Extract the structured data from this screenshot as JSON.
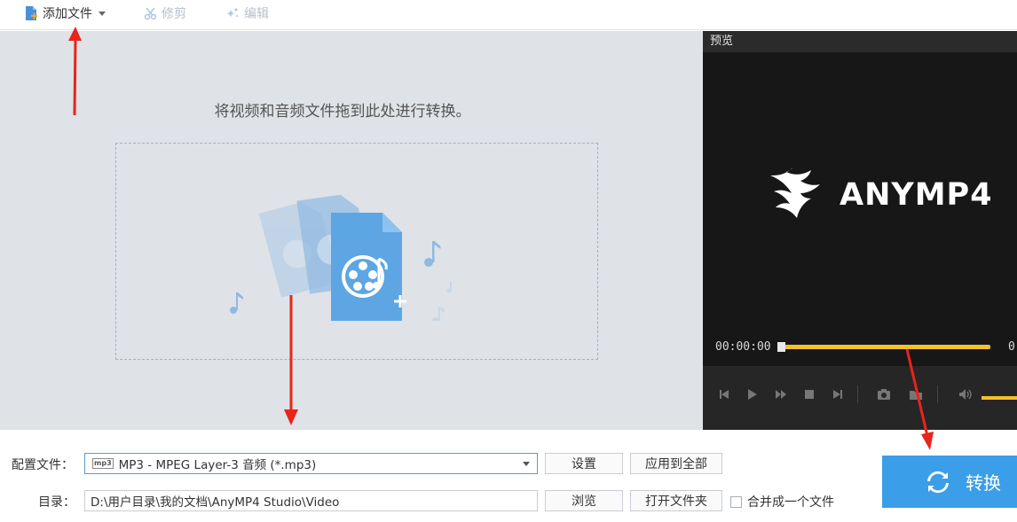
{
  "toolbar": {
    "add_file": "添加文件",
    "trim": "修剪",
    "edit": "编辑"
  },
  "drop_area": {
    "hint": "将视频和音频文件拖到此处进行转换。"
  },
  "preview": {
    "title": "预览",
    "brand": "ANYMP4",
    "time_start": "00:00:00",
    "time_end": "0"
  },
  "settings": {
    "profile_label": "配置文件：",
    "profile_icon": "mp3",
    "profile_value": "MP3 - MPEG Layer-3 音频 (*.mp3)",
    "settings_btn": "设置",
    "apply_all_btn": "应用到全部",
    "dir_label": "目录：",
    "dir_value": "D:\\用户目录\\我的文档\\AnyMP4 Studio\\Video",
    "browse_btn": "浏览",
    "open_folder_btn": "打开文件夹",
    "merge_label": "合并成一个文件",
    "convert_btn": "转换"
  },
  "colors": {
    "accent": "#3b9ee8",
    "progress": "#f5c12a",
    "arrow": "#e8241b"
  }
}
